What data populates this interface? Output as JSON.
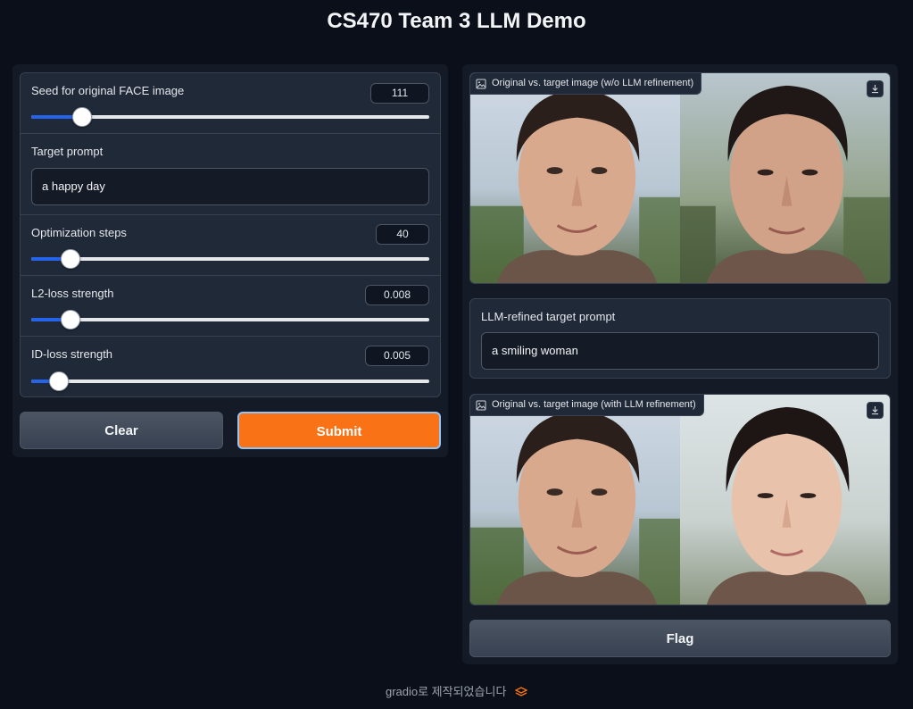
{
  "app": {
    "title": "CS470 Team 3 LLM Demo"
  },
  "inputs": {
    "seed": {
      "label": "Seed for original FACE image",
      "value": "111",
      "level": 0.128
    },
    "target_prompt": {
      "label": "Target prompt",
      "value": "a happy day"
    },
    "steps": {
      "label": "Optimization steps",
      "value": "40",
      "level": 0.098
    },
    "l2": {
      "label": "L2-loss strength",
      "value": "0.008",
      "level": 0.098
    },
    "id": {
      "label": "ID-loss strength",
      "value": "0.005",
      "level": 0.07
    }
  },
  "buttons": {
    "clear": "Clear",
    "submit": "Submit",
    "flag": "Flag"
  },
  "outputs": {
    "image1": {
      "label": "Original vs. target image (w/o LLM refinement)"
    },
    "refined": {
      "label": "LLM-refined target prompt",
      "value": "a smiling woman"
    },
    "image2": {
      "label": "Original vs. target image (with LLM refinement)"
    }
  },
  "footer": {
    "text": "gradio로 제작되었습니다"
  },
  "colors": {
    "accent": "#f97316",
    "slider_fill": "#2563eb",
    "background": "#0b0f19"
  },
  "icons": {
    "image_label": "image-icon",
    "download": "download-icon",
    "footer": "gradio-logo-icon"
  }
}
